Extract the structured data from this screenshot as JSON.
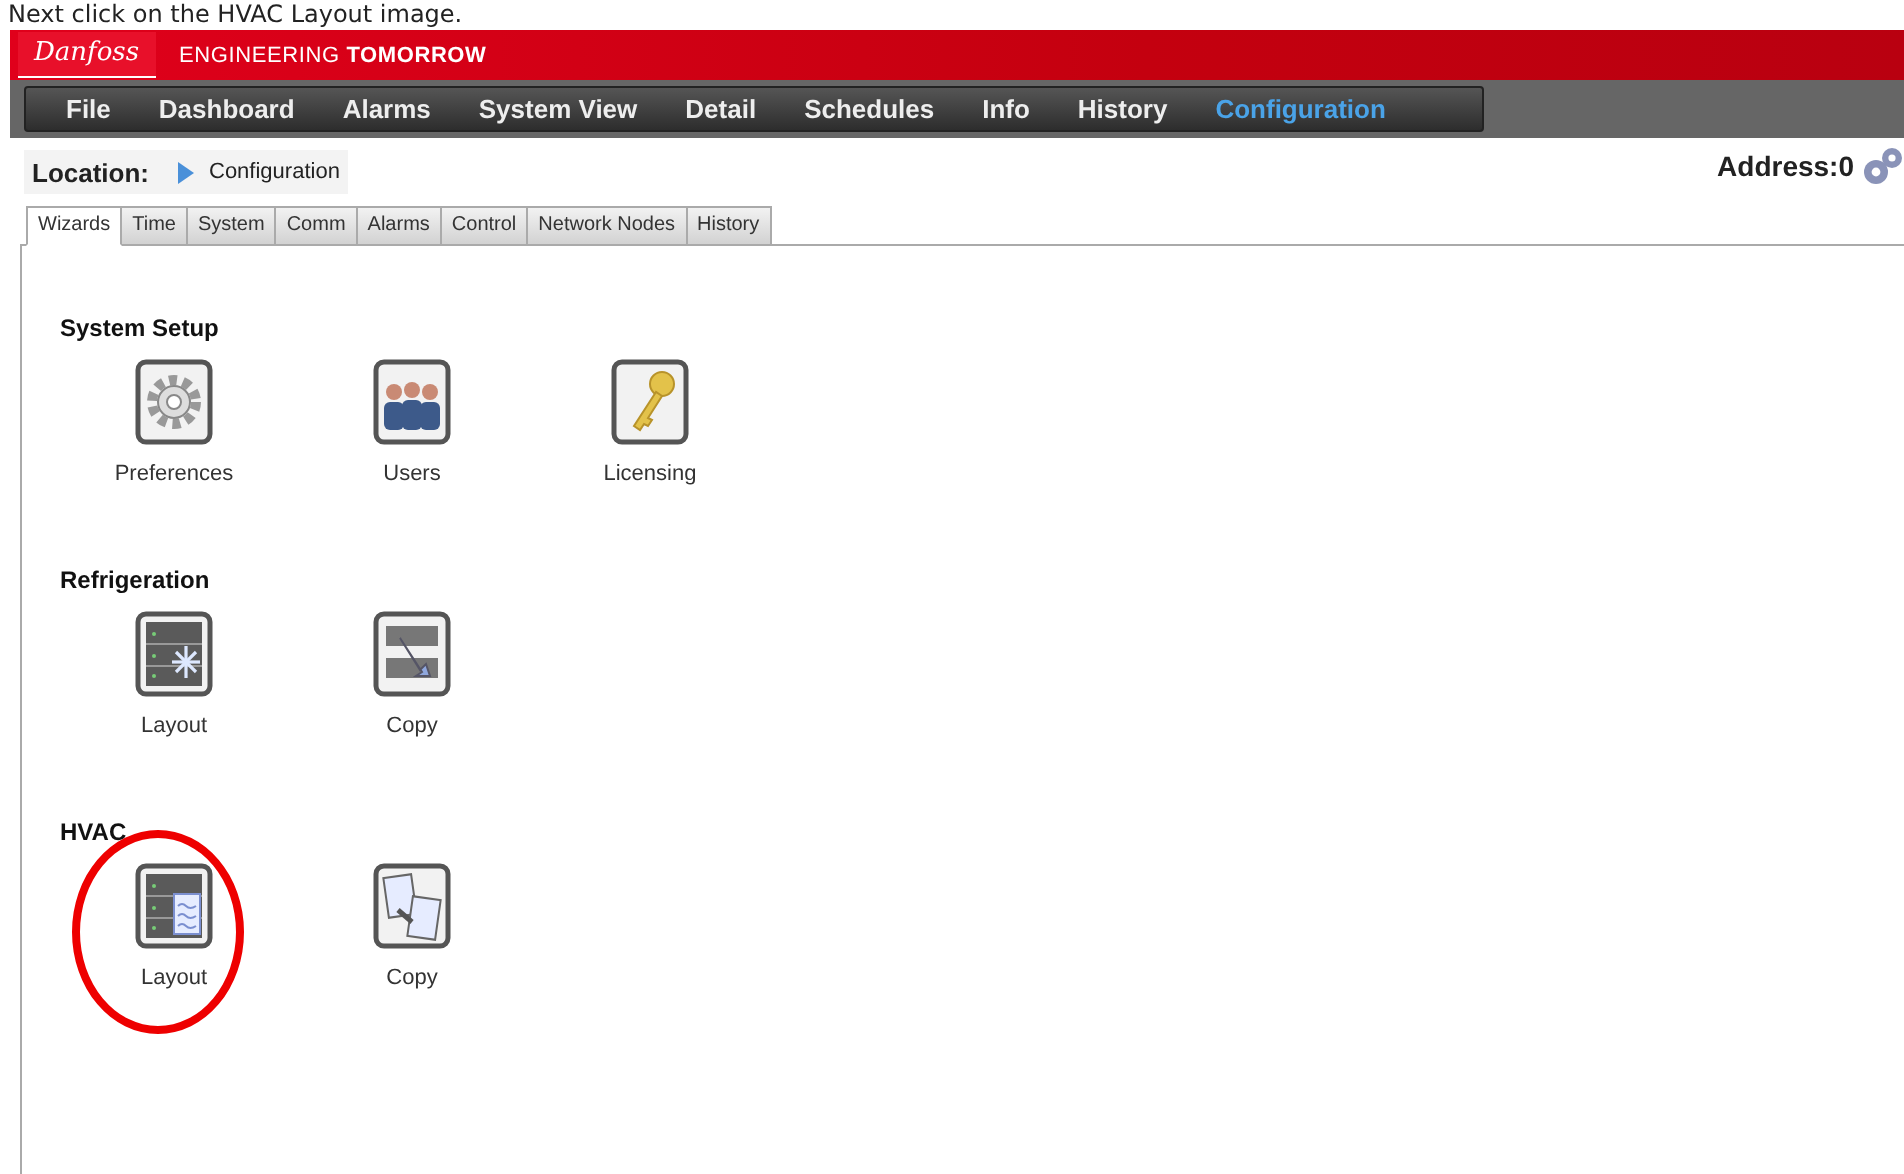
{
  "caption": "Next click on the HVAC Layout image.",
  "header": {
    "logo": "Danfoss",
    "tagline_light": "ENGINEERING",
    "tagline_bold": "TOMORROW"
  },
  "menu": [
    {
      "label": "File",
      "selected": false
    },
    {
      "label": "Dashboard",
      "selected": false
    },
    {
      "label": "Alarms",
      "selected": false
    },
    {
      "label": "System View",
      "selected": false
    },
    {
      "label": "Detail",
      "selected": false
    },
    {
      "label": "Schedules",
      "selected": false
    },
    {
      "label": "Info",
      "selected": false
    },
    {
      "label": "History",
      "selected": false
    },
    {
      "label": "Configuration",
      "selected": true
    }
  ],
  "location": {
    "label": "Location:",
    "value": "Configuration"
  },
  "address": "Address:0",
  "tabs": [
    {
      "label": "Wizards",
      "selected": true
    },
    {
      "label": "Time",
      "selected": false
    },
    {
      "label": "System",
      "selected": false
    },
    {
      "label": "Comm",
      "selected": false
    },
    {
      "label": "Alarms",
      "selected": false
    },
    {
      "label": "Control",
      "selected": false
    },
    {
      "label": "Network Nodes",
      "selected": false
    },
    {
      "label": "History",
      "selected": false
    }
  ],
  "sections": [
    {
      "title": "System Setup",
      "items": [
        {
          "label": "Preferences",
          "highlighted": false
        },
        {
          "label": "Users",
          "highlighted": false
        },
        {
          "label": "Licensing",
          "highlighted": false
        }
      ]
    },
    {
      "title": "Refrigeration",
      "items": [
        {
          "label": "Layout",
          "highlighted": false
        },
        {
          "label": "Copy",
          "highlighted": false
        }
      ]
    },
    {
      "title": "HVAC",
      "items": [
        {
          "label": "Layout",
          "highlighted": true
        },
        {
          "label": "Copy",
          "highlighted": false
        }
      ]
    }
  ]
}
